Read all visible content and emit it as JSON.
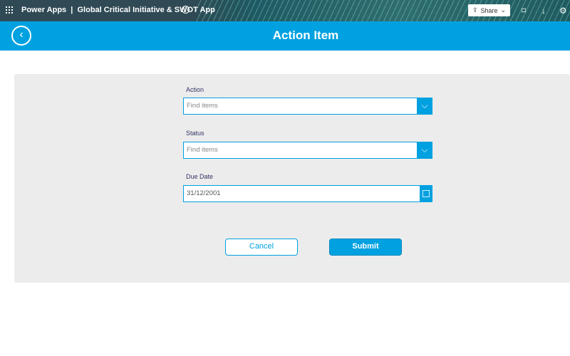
{
  "topbar": {
    "app": "Power Apps",
    "separator": "|",
    "title": "Global Critical Initiative & SWOT App",
    "share": "Share"
  },
  "header": {
    "title": "Action Item"
  },
  "form": {
    "action": {
      "label": "Action",
      "placeholder": "Find items"
    },
    "status": {
      "label": "Status",
      "placeholder": "Find items"
    },
    "due_date": {
      "label": "Due Date",
      "value": "31/12/2001"
    }
  },
  "buttons": {
    "cancel": "Cancel",
    "submit": "Submit"
  }
}
